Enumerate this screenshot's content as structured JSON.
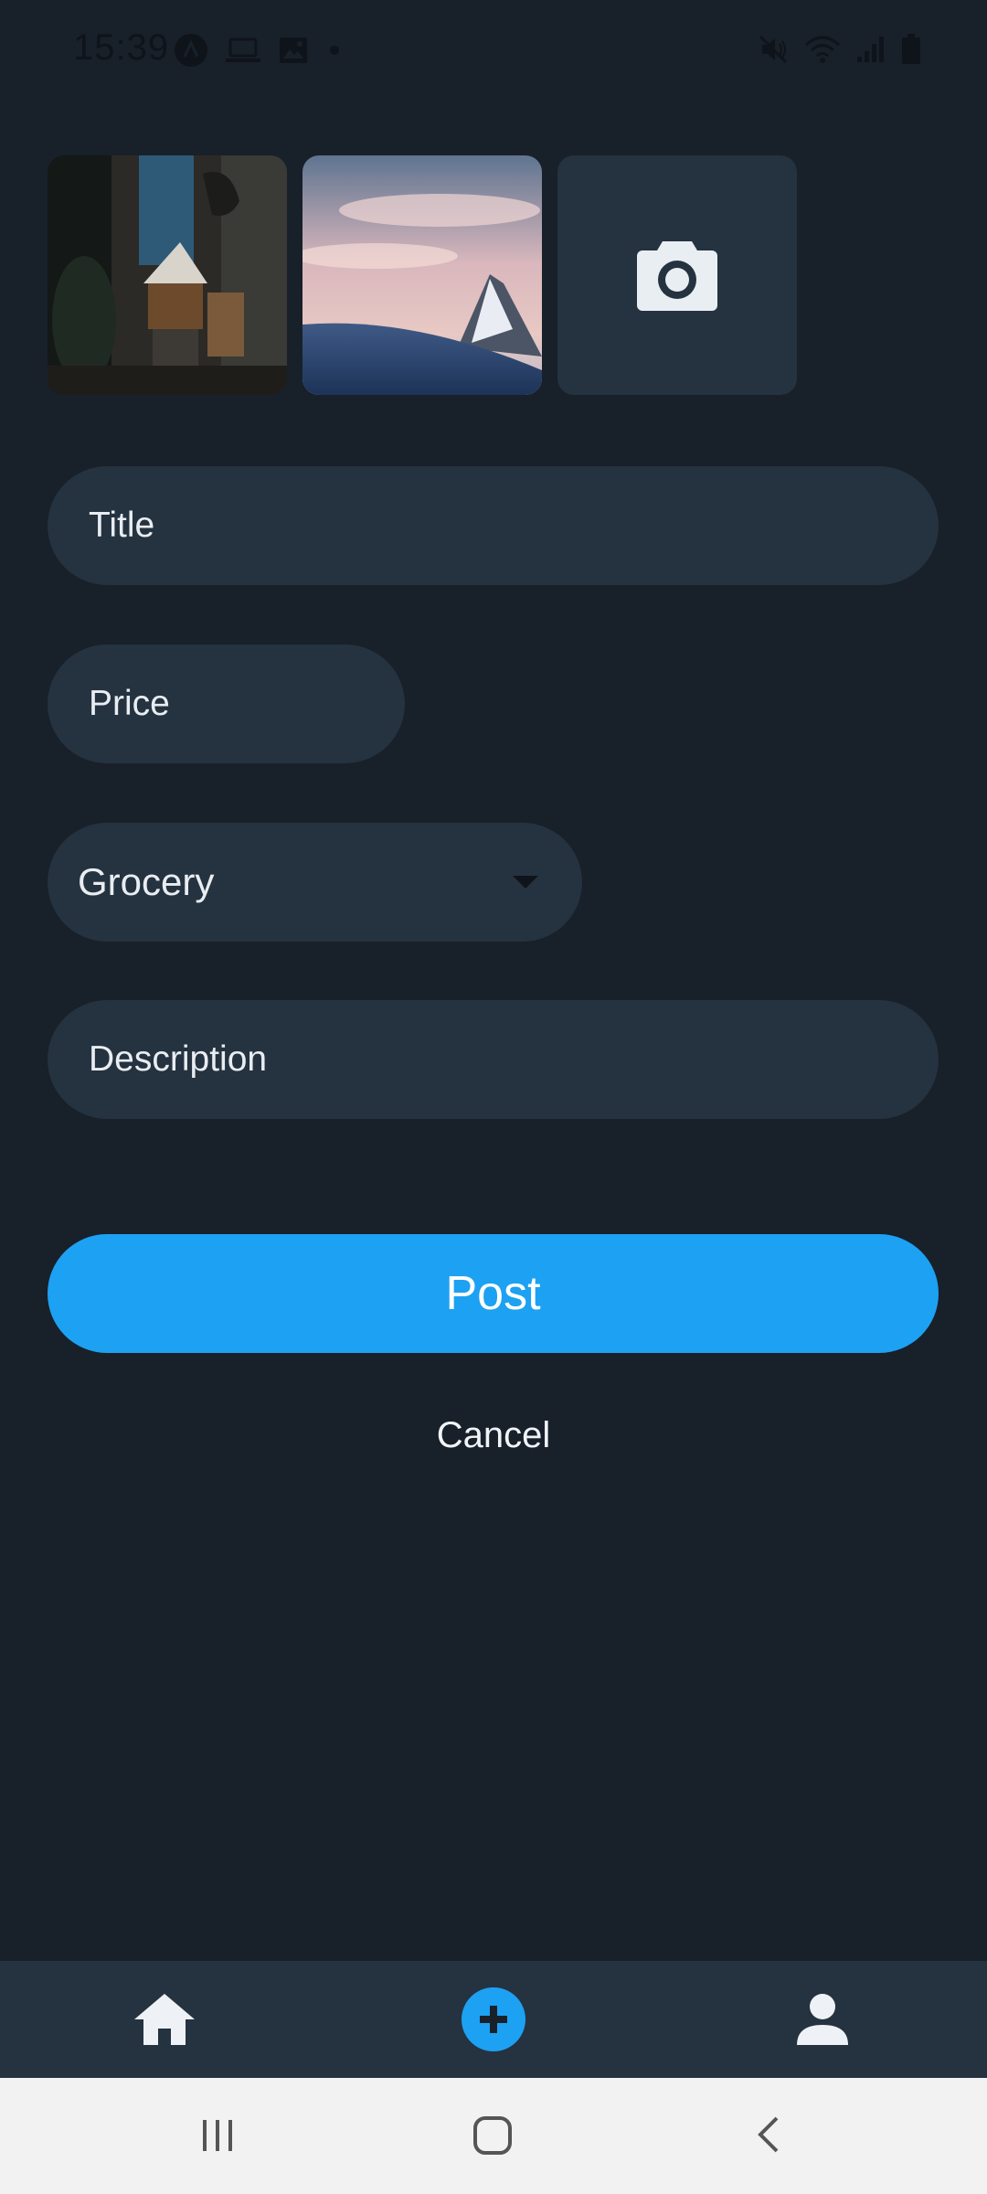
{
  "status_bar": {
    "time": "15:39",
    "left_icons": [
      "app-icon",
      "laptop-icon",
      "image-icon",
      "dot-icon"
    ],
    "right_icons": [
      "mute-icon",
      "wifi-icon",
      "signal-icon",
      "battery-icon"
    ]
  },
  "photos": {
    "items": [
      {
        "name": "coffee-photo"
      },
      {
        "name": "mountain-photo"
      }
    ],
    "add_icon": "camera-icon"
  },
  "form": {
    "title_placeholder": "Title",
    "price_placeholder": "Price",
    "category_value": "Grocery",
    "description_placeholder": "Description"
  },
  "actions": {
    "post_label": "Post",
    "cancel_label": "Cancel"
  },
  "bottom_nav": {
    "items": [
      {
        "icon": "home-icon"
      },
      {
        "icon": "add-icon"
      },
      {
        "icon": "profile-icon"
      }
    ],
    "accent": "#1da1f2"
  },
  "system_nav": [
    "recents-icon",
    "home-button-icon",
    "back-icon"
  ]
}
